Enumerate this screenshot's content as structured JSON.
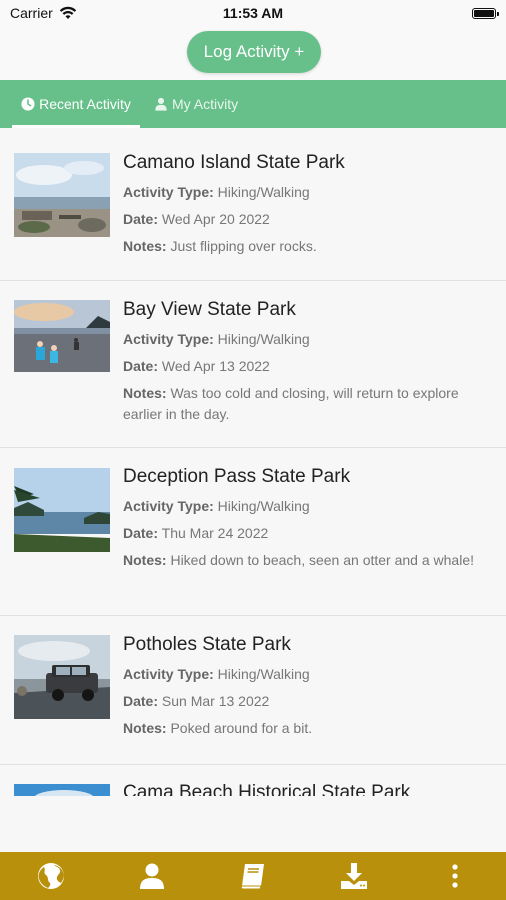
{
  "status_bar": {
    "carrier": "Carrier",
    "time": "11:53 AM"
  },
  "header": {
    "log_button": "Log Activity +"
  },
  "tabs": [
    {
      "label": "Recent Activity",
      "icon": "clock-icon",
      "active": true
    },
    {
      "label": "My Activity",
      "icon": "user-icon",
      "active": false
    }
  ],
  "activities": [
    {
      "park": "Camano Island State Park",
      "type_label": "Activity Type:",
      "type": "Hiking/Walking",
      "date_label": "Date:",
      "date": "Wed Apr 20 2022",
      "notes_label": "Notes:",
      "notes": "Just flipping over rocks."
    },
    {
      "park": "Bay View State Park",
      "type_label": "Activity Type:",
      "type": "Hiking/Walking",
      "date_label": "Date:",
      "date": "Wed Apr 13 2022",
      "notes_label": "Notes:",
      "notes": "Was too cold and closing, will return to explore earlier in the day."
    },
    {
      "park": "Deception Pass State Park",
      "type_label": "Activity Type:",
      "type": "Hiking/Walking",
      "date_label": "Date:",
      "date": "Thu Mar 24 2022",
      "notes_label": "Notes:",
      "notes": "Hiked down to beach, seen an otter and a whale!"
    },
    {
      "park": "Potholes State Park",
      "type_label": "Activity Type:",
      "type": "Hiking/Walking",
      "date_label": "Date:",
      "date": "Sun Mar 13 2022",
      "notes_label": "Notes:",
      "notes": "Poked around for a bit."
    },
    {
      "park": "Cama Beach Historical State Park"
    }
  ],
  "bottom_nav": [
    {
      "icon": "globe-icon"
    },
    {
      "icon": "user-icon"
    },
    {
      "icon": "book-icon"
    },
    {
      "icon": "download-icon"
    },
    {
      "icon": "more-vertical-icon"
    }
  ],
  "colors": {
    "primary_green": "#67c08a",
    "nav_gold": "#b8900c"
  }
}
